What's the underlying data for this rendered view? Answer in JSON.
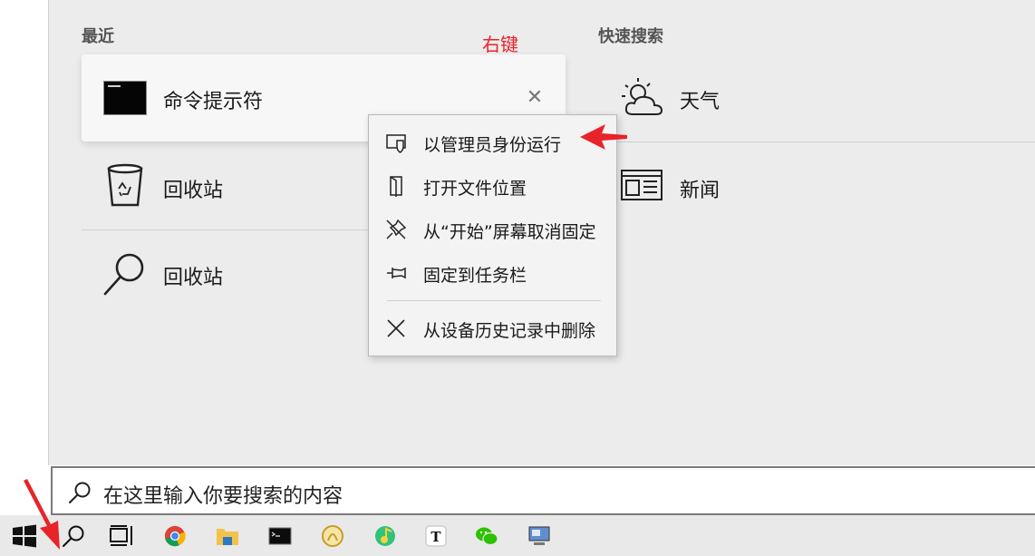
{
  "recent": {
    "title": "最近",
    "items": [
      {
        "label": "命令提示符",
        "icon": "command-prompt-icon"
      },
      {
        "label": "回收站",
        "icon": "recycle-bin-icon"
      },
      {
        "label": "回收站",
        "icon": "search-icon"
      }
    ]
  },
  "quick_search": {
    "title": "快速搜索",
    "items": [
      {
        "label": "天气",
        "icon": "weather-icon"
      },
      {
        "label": "新闻",
        "icon": "news-icon"
      }
    ]
  },
  "annotation": {
    "text": "右键",
    "color": "#e8232a"
  },
  "context_menu": {
    "items": [
      {
        "label": "以管理员身份运行",
        "icon": "shield-icon"
      },
      {
        "label": "打开文件位置",
        "icon": "file-location-icon"
      },
      {
        "label": "从“开始”屏幕取消固定",
        "icon": "unpin-icon"
      },
      {
        "label": "固定到任务栏",
        "icon": "pin-icon"
      },
      {
        "label": "从设备历史记录中删除",
        "icon": "close-icon"
      }
    ]
  },
  "search": {
    "placeholder": "在这里输入你要搜索的内容"
  },
  "taskbar": {
    "items": [
      "windows-start-icon",
      "search-icon",
      "task-view-icon",
      "chrome-icon",
      "file-explorer-icon",
      "command-prompt-icon",
      "navicat-icon",
      "qq-music-icon",
      "typora-icon",
      "wechat-icon",
      "remote-desktop-icon"
    ]
  }
}
